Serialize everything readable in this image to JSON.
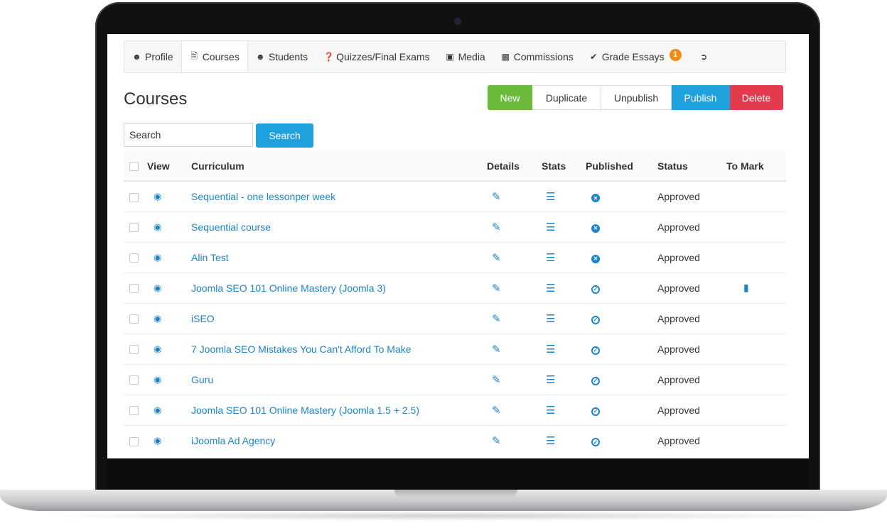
{
  "nav": {
    "items": [
      {
        "label": "Profile",
        "icon": "user-icon"
      },
      {
        "label": "Courses",
        "icon": "file-icon"
      },
      {
        "label": "Students",
        "icon": "user-icon"
      },
      {
        "label": "Quizzes/Final Exams",
        "icon": "question-circle-icon"
      },
      {
        "label": "Media",
        "icon": "image-icon"
      },
      {
        "label": "Commissions",
        "icon": "money-icon"
      },
      {
        "label": "Grade Essays",
        "icon": "check-icon",
        "badge": "1"
      }
    ],
    "logout_icon": "sign-out-icon"
  },
  "page": {
    "title": "Courses"
  },
  "actions": {
    "new": "New",
    "duplicate": "Duplicate",
    "unpublish": "Unpublish",
    "publish": "Publish",
    "delete": "Delete"
  },
  "search": {
    "placeholder": "Search",
    "button": "Search"
  },
  "table": {
    "headers": {
      "view": "View",
      "curriculum": "Curriculum",
      "details": "Details",
      "stats": "Stats",
      "published": "Published",
      "status": "Status",
      "to_mark": "To Mark"
    },
    "rows": [
      {
        "title": "Sequential - one lessonper week",
        "published": false,
        "status": "Approved",
        "to_mark": false
      },
      {
        "title": "Sequential course",
        "published": false,
        "status": "Approved",
        "to_mark": false
      },
      {
        "title": "Alin Test",
        "published": false,
        "status": "Approved",
        "to_mark": false
      },
      {
        "title": "Joomla SEO 101 Online Mastery (Joomla 3)",
        "published": true,
        "status": "Approved",
        "to_mark": true
      },
      {
        "title": "iSEO",
        "published": true,
        "status": "Approved",
        "to_mark": false
      },
      {
        "title": "7 Joomla SEO Mistakes You Can't Afford To Make",
        "published": true,
        "status": "Approved",
        "to_mark": false
      },
      {
        "title": "Guru",
        "published": true,
        "status": "Approved",
        "to_mark": false
      },
      {
        "title": "Joomla SEO 101 Online Mastery (Joomla 1.5 + 2.5)",
        "published": true,
        "status": "Approved",
        "to_mark": false
      },
      {
        "title": "iJoomla Ad Agency",
        "published": true,
        "status": "Approved",
        "to_mark": false
      }
    ]
  },
  "colors": {
    "link": "#1c84c6",
    "new": "#6cba3c",
    "publish": "#1fa1dd",
    "delete": "#e43a4e",
    "badge": "#f28c12"
  }
}
